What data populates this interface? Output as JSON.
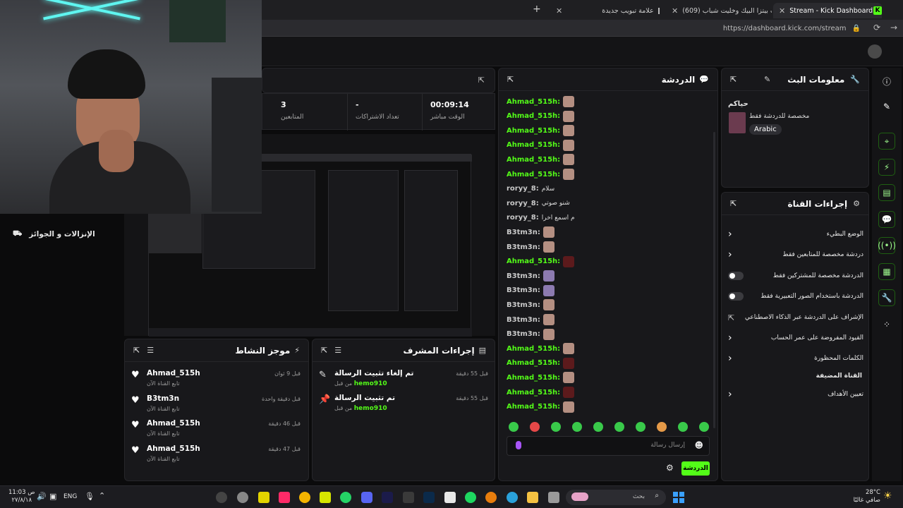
{
  "browser": {
    "tabs": [
      {
        "label": "Stream - Kick Dashboard",
        "active": true
      },
      {
        "label": "(609) سويت بيتزا البيك وخليت شباب...",
        "active": false
      },
      {
        "label": "علامة تبويب جديدة",
        "active": false
      }
    ],
    "url": "https://dashboard.kick.com/stream"
  },
  "stats": {
    "followers_value": "3",
    "followers_label": "المتابعين",
    "subs_value": "-",
    "subs_label": "تعداد الاشتراكات",
    "live_value": "00:09:14",
    "live_label": "الوقت مباشر"
  },
  "sidebar_left": {
    "item_label": "الإنزالات و الجوائز"
  },
  "chat": {
    "title": "الدردشة",
    "messages": [
      {
        "user": "Ahmad_515h:",
        "color": "#53fc18",
        "text": "",
        "emote": "plain"
      },
      {
        "user": "Ahmad_515h:",
        "color": "#53fc18",
        "text": "",
        "emote": "plain"
      },
      {
        "user": "Ahmad_515h:",
        "color": "#53fc18",
        "text": "",
        "emote": "plain"
      },
      {
        "user": "Ahmad_515h:",
        "color": "#53fc18",
        "text": "",
        "emote": "plain"
      },
      {
        "user": "Ahmad_515h:",
        "color": "#53fc18",
        "text": "",
        "emote": "plain"
      },
      {
        "user": "Ahmad_515h:",
        "color": "#53fc18",
        "text": "",
        "emote": "plain"
      },
      {
        "user": "roryy_8:",
        "color": "#c9c9c9",
        "text": "سلام",
        "emote": ""
      },
      {
        "user": "roryy_8:",
        "color": "#c9c9c9",
        "text": "شنو صوتي",
        "emote": ""
      },
      {
        "user": "roryy_8:",
        "color": "#c9c9c9",
        "text": "م اسمع اخرا",
        "emote": ""
      },
      {
        "user": "B3tm3n:",
        "color": "#c9c9c9",
        "text": "",
        "emote": "plain"
      },
      {
        "user": "B3tm3n:",
        "color": "#c9c9c9",
        "text": "",
        "emote": "plain"
      },
      {
        "user": "Ahmad_515h:",
        "color": "#53fc18",
        "text": "",
        "emote": "dark"
      },
      {
        "user": "B3tm3n:",
        "color": "#c9c9c9",
        "text": "",
        "emote": "pur"
      },
      {
        "user": "B3tm3n:",
        "color": "#c9c9c9",
        "text": "",
        "emote": "pur"
      },
      {
        "user": "B3tm3n:",
        "color": "#c9c9c9",
        "text": "",
        "emote": "plain"
      },
      {
        "user": "B3tm3n:",
        "color": "#c9c9c9",
        "text": "",
        "emote": "plain"
      },
      {
        "user": "B3tm3n:",
        "color": "#c9c9c9",
        "text": "",
        "emote": "plain"
      },
      {
        "user": "Ahmad_515h:",
        "color": "#53fc18",
        "text": "",
        "emote": "plain"
      },
      {
        "user": "Ahmad_515h:",
        "color": "#53fc18",
        "text": "",
        "emote": "dark"
      },
      {
        "user": "Ahmad_515h:",
        "color": "#53fc18",
        "text": "",
        "emote": "plain"
      },
      {
        "user": "Ahmad_515h:",
        "color": "#53fc18",
        "text": "",
        "emote": "dark"
      },
      {
        "user": "Ahmad_515h:",
        "color": "#53fc18",
        "text": "",
        "emote": "plain"
      }
    ],
    "input_placeholder": "إرسال رسالة",
    "send_label": "الدردشة"
  },
  "stream_info": {
    "title": "معلومات البث",
    "stream_title": "حياكم",
    "category": "مخصصة للدردشة فقط",
    "language": "Arabic"
  },
  "channel_actions": {
    "title": "إجراءات القناة",
    "rows": [
      {
        "label": "الوضع البطيء",
        "control": "chevron"
      },
      {
        "label": "دردشة مخصصة للمتابعين فقط",
        "control": "chevron"
      },
      {
        "label": "الدردشة مخصصة للمشتركين فقط",
        "control": "toggle"
      },
      {
        "label": "الدردشة باستخدام الصور التعبيرية فقط",
        "control": "toggle"
      },
      {
        "label": "الإشراف على الدردشة عبر الذكاء الاصطناعي",
        "control": "external"
      },
      {
        "label": "القيود المفروضة على عمر الحساب",
        "control": "chevron"
      },
      {
        "label": "الكلمات المحظورة",
        "control": "chevron"
      }
    ],
    "section_label": "القناة المضيفة",
    "host_row": {
      "label": "تعيين الأهداف",
      "control": "chevron"
    }
  },
  "mod_actions": {
    "title": "إجراءات المشرف",
    "items": [
      {
        "title": "تم إلغاء تثبيت الرسالة",
        "by": "من قبل",
        "user": "hemo910",
        "time": "قبل 55 دقيقة"
      },
      {
        "title": "تم تثبيت الرسالة",
        "by": "من قبل",
        "user": "hemo910",
        "time": "قبل 55 دقيقة"
      }
    ]
  },
  "activity": {
    "title": "موجز النشاط",
    "items": [
      {
        "name": "Ahmad_515h",
        "sub": "تابع القناة الآن",
        "time": "قبل 9 ثوان"
      },
      {
        "name": "B3tm3n",
        "sub": "تابع القناة الآن",
        "time": "قبل دقيقة واحدة"
      },
      {
        "name": "Ahmad_515h",
        "sub": "تابع القناة الآن",
        "time": "قبل 46 دقيقة"
      },
      {
        "name": "Ahmad_515h",
        "sub": "تابع القناة الآن",
        "time": "قبل 47 دقيقة"
      }
    ]
  },
  "taskbar": {
    "time": "11:03 ص",
    "date": "٢٧/٨/١٨",
    "lang": "ENG",
    "search_placeholder": "بحث",
    "weather_temp": "28°C",
    "weather_desc": "صافي غالبًا"
  },
  "colors": {
    "accent": "#53fc18",
    "panel": "#18181b",
    "bg": "#0b0b0c"
  }
}
